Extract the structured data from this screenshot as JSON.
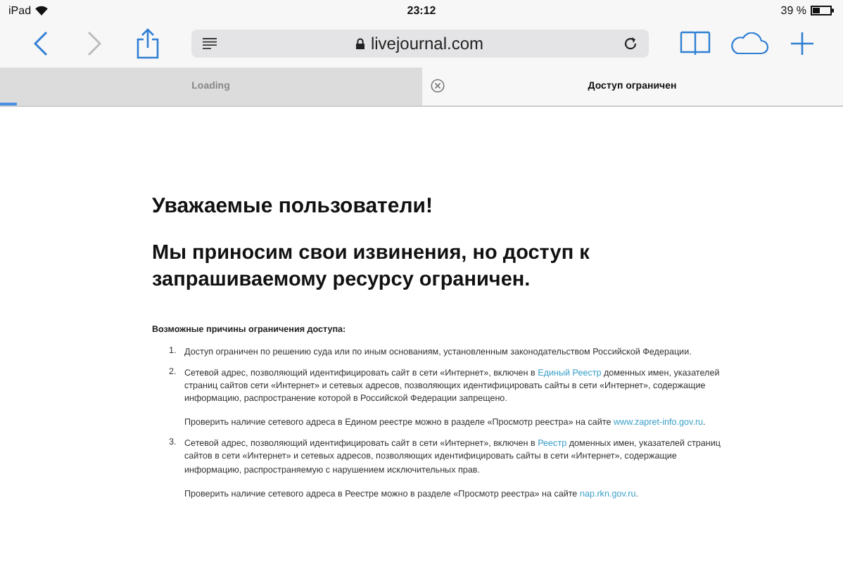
{
  "status_bar": {
    "device": "iPad",
    "time": "23:12",
    "battery": "39 %"
  },
  "toolbar": {
    "back_disabled": false,
    "forward_disabled": true,
    "url": "livejournal.com"
  },
  "tabs": [
    {
      "label": "Loading",
      "selected": false,
      "level": 0.04
    },
    {
      "label": "Доступ ограничен",
      "selected": true
    }
  ],
  "page": {
    "heading": "Уважаемые пользователи!",
    "subheading": "Мы приносим свои извинения, но доступ к запрашиваемому ресурсу ограничен.",
    "reasons_title": "Возможные причины ограничения доступа:",
    "reasons": [
      {
        "number": "1.",
        "paragraphs": [
          [
            {
              "kind": "text",
              "text": "Доступ ограничен  по решению суда или по иным основаниям, установленным законодательством Российской Федерации."
            }
          ]
        ]
      },
      {
        "number": "2.",
        "paragraphs": [
          [
            {
              "kind": "text",
              "text": "Сетевой адрес, позволяющий идентифицировать сайт в сети «Интернет», включен в "
            },
            {
              "kind": "link",
              "text": "Единый Реестр"
            },
            {
              "kind": "text",
              "text": " доменных имен, указателей страниц сайтов сети «Интернет» и сетевых адресов, позволяющих идентифицировать сайты в сети «Интернет», содержащие информацию, распространение которой в Российской Федерации запрещено."
            }
          ],
          [
            {
              "kind": "text",
              "text": "Проверить наличие сетевого адреса в Едином реестре можно в разделе «Просмотр реестра» на сайте "
            },
            {
              "kind": "link",
              "text": "www.zapret-info.gov.ru"
            },
            {
              "kind": "text",
              "text": "."
            }
          ]
        ]
      },
      {
        "number": "3.",
        "paragraphs": [
          [
            {
              "kind": "text",
              "text": "Сетевой адрес, позволяющий идентифицировать сайт в сети «Интернет», включен в "
            },
            {
              "kind": "link",
              "text": "Реестр"
            },
            {
              "kind": "text",
              "text": " доменных имен, указателей страниц сайтов в сети «Интернет» и сетевых адресов, позволяющих идентифицировать сайты в сети «Интернет», содержащие информацию, распространяемую с нарушением исключительных прав."
            }
          ],
          [
            {
              "kind": "text",
              "text": "Проверить наличие сетевого адреса в Реестре можно в разделе «Просмотр реестра» на сайте "
            },
            {
              "kind": "link",
              "text": "nap.rkn.gov.ru"
            },
            {
              "kind": "text",
              "text": "."
            }
          ]
        ]
      }
    ]
  }
}
